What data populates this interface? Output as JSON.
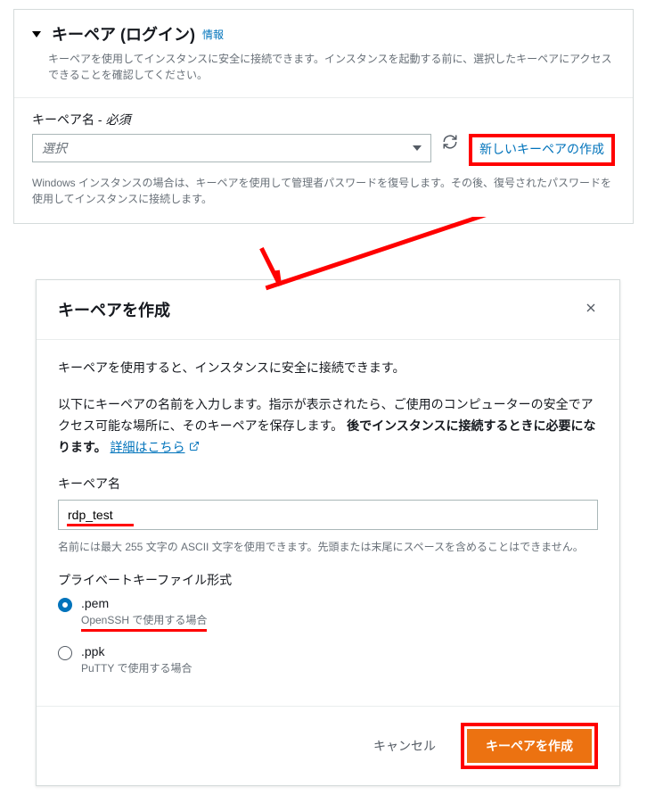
{
  "panel": {
    "title": "キーペア (ログイン)",
    "info_link": "情報",
    "description": "キーペアを使用してインスタンスに安全に接続できます。インスタンスを起動する前に、選択したキーペアにアクセスできることを確認してください。",
    "field_label": "キーペア名 - ",
    "required": "必須",
    "select_placeholder": "選択",
    "create_link": "新しいキーペアの作成",
    "help_text": "Windows インスタンスの場合は、キーペアを使用して管理者パスワードを復号します。その後、復号されたパスワードを使用してインスタンスに接続します。"
  },
  "modal": {
    "title": "キーペアを作成",
    "intro": "キーペアを使用すると、インスタンスに安全に接続できます。",
    "instruction_1": "以下にキーペアの名前を入力します。指示が表示されたら、ご使用のコンピューターの安全でアクセス可能な場所に、そのキーペアを保存します。 ",
    "instruction_bold": "後でインスタンスに接続するときに必要になります。",
    "learn_more": "詳細はこちら",
    "name_label": "キーペア名",
    "name_value": "rdp_test",
    "name_help": "名前には最大 255 文字の ASCII 文字を使用できます。先頭または末尾にスペースを含めることはできません。",
    "format_label": "プライベートキーファイル形式",
    "pem_label": ".pem",
    "pem_desc": "OpenSSH で使用する場合",
    "ppk_label": ".ppk",
    "ppk_desc": "PuTTY で使用する場合",
    "cancel": "キャンセル",
    "create": "キーペアを作成"
  }
}
